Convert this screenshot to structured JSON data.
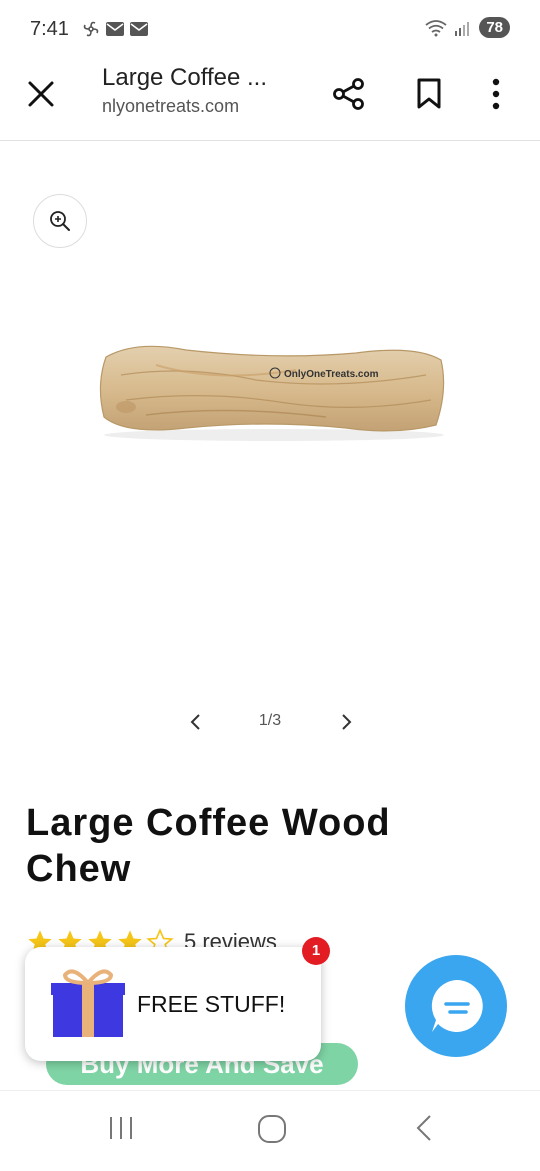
{
  "status_bar": {
    "time": "7:41",
    "battery": "78"
  },
  "browser": {
    "title": "Large Coffee ...",
    "domain": "nlyonetreats.com"
  },
  "gallery": {
    "counter": "1/3",
    "image_brand_text": "OnlyOneTreats.com"
  },
  "product": {
    "title": "Large Coffee Wood Chew",
    "rating_stars": 4,
    "reviews": "5 reviews",
    "bundle_button": "Buy More And Save"
  },
  "popup": {
    "label": "FREE STUFF!",
    "badge_count": "1"
  },
  "colors": {
    "chat_bubble": "#3aa6ef",
    "bundle_button": "#7fd4a5",
    "badge": "#e31b23",
    "star": "#f5c518"
  }
}
